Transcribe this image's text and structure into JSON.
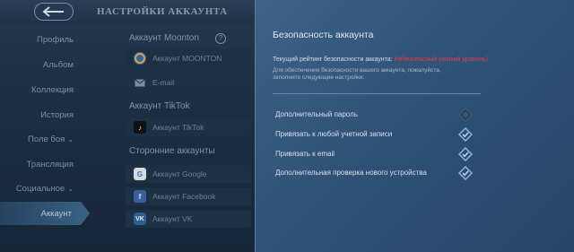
{
  "background_screen": {
    "title": "НАСТРОЙКИ АККАУНТА",
    "sidebar": {
      "items": [
        {
          "label": "Профиль"
        },
        {
          "label": "Альбом"
        },
        {
          "label": "Коллекция"
        },
        {
          "label": "История"
        },
        {
          "label": "Поле боя"
        },
        {
          "label": "Трансляция"
        },
        {
          "label": "Социальное"
        },
        {
          "label": "Аккаунт"
        }
      ]
    },
    "accounts": {
      "moonton_header": "Аккаунт Moonton",
      "moonton_help": "?",
      "moonton_label": "Аккаунт MOONTON",
      "email_label": "E-mail",
      "tiktok_header": "Аккаунт TikTok",
      "tiktok_label": "Аккаунт TikTok",
      "thirdparty_header": "Сторонние аккаунты",
      "google_label": "Аккаунт Google",
      "facebook_label": "Аккаунт Facebook",
      "vk_label": "Аккаунт VK"
    }
  },
  "security_panel": {
    "title": "Безопасность аккаунта",
    "rating_label": "Текущий рейтинг безопасности аккаунта: ",
    "rating_value": "Небезопасный (низкий уровень)",
    "hint": "Для обеспечения безопасности вашего аккаунта, пожалуйста, заполните следующие настройки.",
    "options": [
      {
        "label": "Дополнительный пароль",
        "icon": "shield-dim-icon"
      },
      {
        "label": "Привязать к любой учетной записи",
        "icon": "shield-check-icon"
      },
      {
        "label": "Привязать к email",
        "icon": "shield-check-icon"
      },
      {
        "label": "Дополнительная проверка нового устройства",
        "icon": "shield-check-icon"
      }
    ]
  },
  "colors": {
    "panel_bg": "#2f5176",
    "rating_danger": "#e0404a",
    "check_icon": "#8fb4de"
  }
}
